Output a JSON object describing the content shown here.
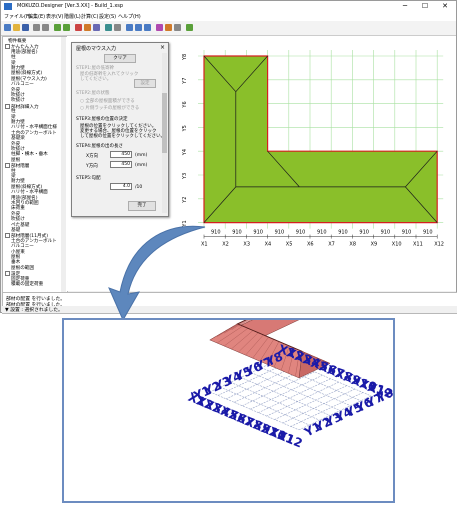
{
  "window": {
    "title": "MOKUZO.Designer [Ver.3.XX] - Build_1.xsp",
    "minimize": "─",
    "maximize": "☐",
    "close": "✕"
  },
  "menu": [
    "ファイル(F)",
    "編集(E)",
    "表示(V)",
    "階層(L)",
    "計算(C)",
    "設定(S)",
    "ヘルプ(H)"
  ],
  "tree": {
    "items": [
      {
        "label": "物件概要",
        "indent": 1
      },
      {
        "label": "かんたん入力",
        "indent": 0
      },
      {
        "label": "用途(部屋名)",
        "indent": 2
      },
      {
        "label": "柱",
        "indent": 2
      },
      {
        "label": "梁",
        "indent": 2
      },
      {
        "label": "耐力壁",
        "indent": 2
      },
      {
        "label": "屋根(斜線方式)",
        "indent": 2
      },
      {
        "label": "屋根(マウス入力)",
        "indent": 2
      },
      {
        "label": "バルコニー",
        "indent": 2
      },
      {
        "label": "外皮",
        "indent": 2
      },
      {
        "label": "吹抜け",
        "indent": 2
      },
      {
        "label": "吹抜け",
        "indent": 2
      },
      {
        "label": "部材詳細入力",
        "indent": 0
      },
      {
        "label": "柱",
        "indent": 2
      },
      {
        "label": "梁",
        "indent": 2
      },
      {
        "label": "耐力壁",
        "indent": 2
      },
      {
        "label": "ハリ付・水平構面仕様",
        "indent": 2
      },
      {
        "label": "土台のアンカーボルト",
        "indent": 2
      },
      {
        "label": "基礎梁",
        "indent": 2
      },
      {
        "label": "外皮",
        "indent": 2
      },
      {
        "label": "吹抜け",
        "indent": 2
      },
      {
        "label": "柱脚・横木・垂木",
        "indent": 2
      },
      {
        "label": "屋根",
        "indent": 2
      },
      {
        "label": "部材階層",
        "indent": 0
      },
      {
        "label": "柱",
        "indent": 2
      },
      {
        "label": "梁",
        "indent": 2
      },
      {
        "label": "耐力壁",
        "indent": 2
      },
      {
        "label": "屋根(斜線方式)",
        "indent": 2
      },
      {
        "label": "ハリ付・水平構面",
        "indent": 2
      },
      {
        "label": "用途(部屋名)",
        "indent": 2
      },
      {
        "label": "水回りの範囲",
        "indent": 2
      },
      {
        "label": "床荷重",
        "indent": 2
      },
      {
        "label": "外皮",
        "indent": 2
      },
      {
        "label": "吹抜け",
        "indent": 2
      },
      {
        "label": "ペた基礎",
        "indent": 2
      },
      {
        "label": "基礎",
        "indent": 2
      },
      {
        "label": "部材階層(11月式)",
        "indent": 0
      },
      {
        "label": "土台のアンカーボルト",
        "indent": 2
      },
      {
        "label": "バルコニー",
        "indent": 2
      },
      {
        "label": "小屋束",
        "indent": 2
      },
      {
        "label": "屋根",
        "indent": 2
      },
      {
        "label": "垂木",
        "indent": 2
      },
      {
        "label": "屋根の範囲",
        "indent": 2
      },
      {
        "label": "設定",
        "indent": 0
      },
      {
        "label": "固定荷重",
        "indent": 2
      },
      {
        "label": "積載の固定荷重",
        "indent": 2
      }
    ]
  },
  "dialog": {
    "title": "屋根のマウス入力",
    "close": "×",
    "top_button": "クリア",
    "step1": "STEP1:屋の低寄幹",
    "step1_hint": "屋の低寄幹を入れてクリック\nしてください。",
    "step1_button": "設定",
    "step2": "STEP2:屋の状態",
    "radio1": "全部の屋根面積ができる",
    "radio2": "片側ラッチの屋根ができる",
    "step3": "STEP3:屋根の位置の決定",
    "step3_hint1": "屋根の位置をクリックしてください。",
    "step3_hint2": "変更する場合、屋根の位置をクリック",
    "step3_hint3": "して屋根の位置をクリックしてください。",
    "step4": "STEP4:屋根の出の長さ",
    "x_label": "X方向",
    "x_value": "450",
    "y_label": "Y方向",
    "y_value": "450",
    "unit": "(mm)",
    "step5": "STEP5:勾配",
    "pitch_value": "4.0",
    "pitch_unit": "/10",
    "finish": "完了"
  },
  "messages": [
    "部材の配置 を行いました。",
    "部材の配置 を行いました。"
  ],
  "status": "▼ 設置 : 選択されました。",
  "plan": {
    "x_labels": [
      "X1",
      "X2",
      "X3",
      "X4",
      "X5",
      "X6",
      "X7",
      "X8",
      "X9",
      "X10",
      "X11",
      "X12"
    ],
    "y_labels": [
      "Y1",
      "Y2",
      "Y3",
      "Y4",
      "Y5",
      "Y6",
      "Y7",
      "Y8"
    ],
    "dim": "910",
    "roof_color": "#8abf2a",
    "outline_color": "#d42020"
  },
  "view3d": {
    "x_labels": [
      "X1",
      "X2",
      "X3",
      "X4",
      "X5",
      "X6",
      "X7",
      "X8",
      "X9",
      "X10",
      "X11",
      "X12"
    ],
    "y_labels": [
      "Y1",
      "Y2",
      "Y3",
      "Y4",
      "Y5",
      "Y6",
      "Y7",
      "Y8"
    ],
    "label_color": "#1a1aa8",
    "roof_color": "#e58a87"
  }
}
